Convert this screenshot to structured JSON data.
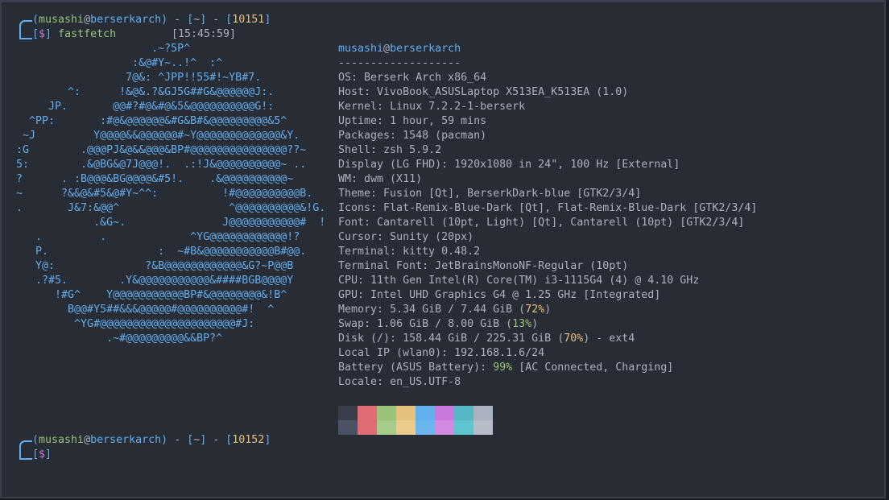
{
  "prompt1": {
    "user": "musashi",
    "at": "@",
    "host": "berserkarch",
    "dir": "~",
    "hist": "10151",
    "sym": "$",
    "command": "fastfetch",
    "time": "[15:45:59]"
  },
  "prompt2": {
    "user": "musashi",
    "at": "@",
    "host": "berserkarch",
    "dir": "~",
    "hist": "10152",
    "sym": "$"
  },
  "logo": [
    "                     .~?5P^",
    "                  :&@#Y~..!^  :^",
    "                 7@&: ^JPP!!55#!~YB#7.",
    "        ^:      !&@&.?&GJ5G##G&@@@@@@J:.",
    "     JP.       @@#?#@&#@&5&@@@@@@@@@@G!:",
    "  ^PP:       :#@&@@@@@@&#G&B#&@@@@@@@@@&5^",
    " ~J         Y@@@@&&@@@@@@#~Y@@@@@@@@@@@@@&Y.",
    ":G        .@@@PJ&@&&@@@&BP#@@@@@@@@@@@@@@@??~",
    "5:        .&@BG&@7J@@@!.  .:!J&@@@@@@@@@@~ ..",
    "?      . :B@@@&BG@@@@&#5!.    .&@@@@@@@@@@~",
    "~      ?&&@&#5&@#Y~^^:          !#@@@@@@@@@@B.",
    ".       J&7:&@@^                 ^@@@@@@@@@@&!G.",
    "            .&G~.               J@@@@@@@@@@@#  !",
    "   .         .             ^YG@@@@@@@@@@@@!?",
    "   P.                 :  ~#B&@@@@@@@@@@@B#@@.",
    "   Y@:              ?&B@@@@@@@@@@@@&G?~P@@B",
    "   .?#5.        .Y&@@@@@@@@@@@&####BGB@@@@Y",
    "      !#G^    Y@@@@@@@@@@@BP#&@@@@@@@@&!B^",
    "        B@@#Y5##&&&@@@@@#@@@@@@@@@@#!  ^",
    "         ^YG#@@@@@@@@@@@@@@@@@@@@@#J:",
    "              .~#@@@@@@@@@&&BP?^"
  ],
  "info": {
    "user": "musashi",
    "at": "@",
    "host": "berserkarch",
    "separator": "-------------------",
    "lines": [
      {
        "key": "OS",
        "value": "Berserk Arch x86_64"
      },
      {
        "key": "Host",
        "value": "VivoBook_ASUSLaptop X513EA_K513EA (1.0)"
      },
      {
        "key": "Kernel",
        "value": "Linux 7.2.2-1-berserk"
      },
      {
        "key": "Uptime",
        "value": "1 hour, 59 mins"
      },
      {
        "key": "Packages",
        "value": "1548 (pacman)"
      },
      {
        "key": "Shell",
        "value": "zsh 5.9.2"
      },
      {
        "key": "Display (LG FHD)",
        "value": "1920x1080 in 24\", 100 Hz [External]"
      },
      {
        "key": "WM",
        "value": "dwm (X11)"
      },
      {
        "key": "Theme",
        "value": "Fusion [Qt], BerserkDark-blue [GTK2/3/4]"
      },
      {
        "key": "Icons",
        "value": "Flat-Remix-Blue-Dark [Qt], Flat-Remix-Blue-Dark [GTK2/3/4]"
      },
      {
        "key": "Font",
        "value": "Cantarell (10pt, Light) [Qt], Cantarell (10pt) [GTK2/3/4]"
      },
      {
        "key": "Cursor",
        "value": "Sunity (20px)"
      },
      {
        "key": "Terminal",
        "value": "kitty 0.48.2"
      },
      {
        "key": "Terminal Font",
        "value": "JetBrainsMonoNF-Regular (10pt)"
      },
      {
        "key": "CPU",
        "value": "11th Gen Intel(R) Core(TM) i3-1115G4 (4) @ 4.10 GHz"
      },
      {
        "key": "GPU",
        "value": "Intel UHD Graphics G4 @ 1.25 GHz [Integrated]"
      }
    ],
    "memory": {
      "key": "Memory",
      "value": "5.34 GiB / 7.44 GiB (",
      "pct": "72%",
      "close": ")"
    },
    "swap": {
      "key": "Swap",
      "value": "1.06 GiB / 8.00 GiB (",
      "pct": "13%",
      "close": ")"
    },
    "disk": {
      "key": "Disk (/)",
      "value": "158.44 GiB / 225.31 GiB (",
      "pct": "70%",
      "close": ") - ext4"
    },
    "localip": {
      "key": "Local IP (wlan0)",
      "value": "192.168.1.6/24"
    },
    "battery": {
      "key": "Battery (ASUS Battery)",
      "pct": "99%",
      "value": "[AC Connected, Charging]"
    },
    "locale": {
      "key": "Locale",
      "value": "en_US.UTF-8"
    }
  },
  "colors": {
    "top": [
      "#3a3f4b",
      "#e06c75",
      "#98c379",
      "#e5c07b",
      "#61afef",
      "#c678dd",
      "#56b6c2",
      "#abb2bf"
    ],
    "bottom": [
      "#4b5263",
      "#e06c75",
      "#a6cc8a",
      "#ebcb8b",
      "#6cb6f0",
      "#d08ae0",
      "#5ec4cf",
      "#b6bdc8"
    ]
  }
}
